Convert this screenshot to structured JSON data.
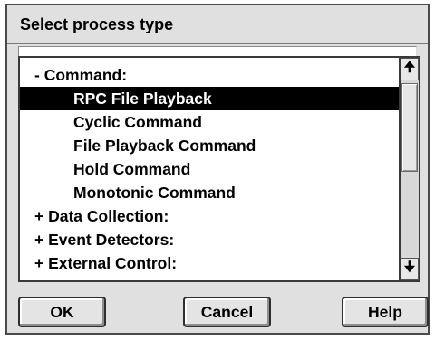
{
  "dialog": {
    "title": "Select process type"
  },
  "list": {
    "items": [
      {
        "label": "- Command:",
        "level": 0,
        "selected": false
      },
      {
        "label": "RPC File Playback",
        "level": 1,
        "selected": true
      },
      {
        "label": "Cyclic Command",
        "level": 1,
        "selected": false
      },
      {
        "label": "File Playback Command",
        "level": 1,
        "selected": false
      },
      {
        "label": "Hold Command",
        "level": 1,
        "selected": false
      },
      {
        "label": "Monotonic Command",
        "level": 1,
        "selected": false
      },
      {
        "label": "+ Data Collection:",
        "level": 0,
        "selected": false
      },
      {
        "label": "+ Event Detectors:",
        "level": 0,
        "selected": false
      },
      {
        "label": "+ External Control:",
        "level": 0,
        "selected": false
      }
    ]
  },
  "scrollbar": {
    "up_icon": "arrow-up-icon",
    "down_icon": "arrow-down-icon",
    "up_glyph": "🠉",
    "down_glyph": "🠋"
  },
  "buttons": {
    "ok": "OK",
    "cancel": "Cancel",
    "help": "Help"
  },
  "colors": {
    "dialog_bg": "#e0e0e0",
    "selection_bg": "#000000",
    "selection_text": "#ffffff"
  }
}
